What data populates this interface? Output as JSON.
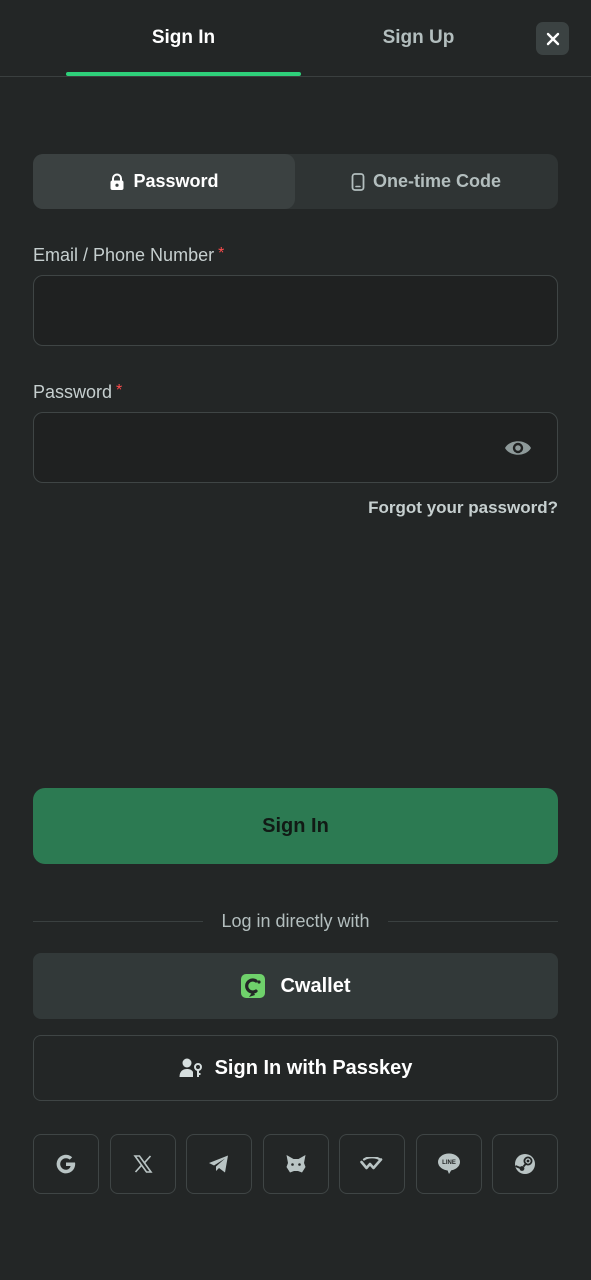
{
  "header": {
    "tabs": [
      {
        "label": "Sign In",
        "active": true
      },
      {
        "label": "Sign Up",
        "active": false
      }
    ],
    "close_icon": "close-icon"
  },
  "login_mode": {
    "options": [
      {
        "label": "Password",
        "icon": "lock-icon",
        "active": true
      },
      {
        "label": "One-time Code",
        "icon": "phone-icon",
        "active": false
      }
    ]
  },
  "form": {
    "email": {
      "label": "Email / Phone Number",
      "required_mark": "*",
      "value": "",
      "placeholder": ""
    },
    "password": {
      "label": "Password",
      "required_mark": "*",
      "value": "",
      "placeholder": ""
    },
    "forgot_label": "Forgot your password?"
  },
  "actions": {
    "sign_in_label": "Sign In",
    "divider_text": "Log in directly with",
    "cwallet_label": "Cwallet",
    "passkey_label": "Sign In with Passkey"
  },
  "social": [
    {
      "name": "google-icon"
    },
    {
      "name": "x-icon"
    },
    {
      "name": "telegram-icon"
    },
    {
      "name": "metamask-icon"
    },
    {
      "name": "walletconnect-icon"
    },
    {
      "name": "line-icon"
    },
    {
      "name": "steam-icon"
    }
  ],
  "colors": {
    "accent": "#2ed07a",
    "primary_button": "#2c7a52",
    "required": "#ff4c4c",
    "background": "#232626"
  }
}
